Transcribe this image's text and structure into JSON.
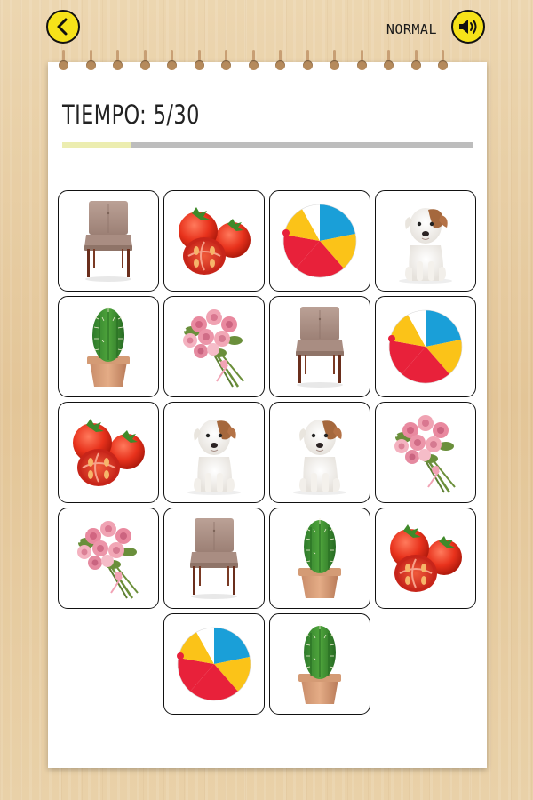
{
  "header": {
    "mode_label": "NORMAL",
    "back_icon": "chevron-left-icon",
    "sound_icon": "speaker-icon"
  },
  "timer": {
    "label": "TIEMPO: 5/30",
    "elapsed": 5,
    "total": 30,
    "progress_fraction": 0.1667,
    "fill_color": "#ecedb0",
    "track_color": "#bdbdbd"
  },
  "colors": {
    "button_yellow": "#f6e219",
    "background_wood": "#e8cfa6"
  },
  "board": {
    "rows": [
      [
        "chair",
        "tomato",
        "ball",
        "dog"
      ],
      [
        "cactus",
        "flowers",
        "chair",
        "ball"
      ],
      [
        "tomato",
        "dog",
        "dog",
        "flowers"
      ],
      [
        "flowers",
        "chair",
        "cactus",
        "tomato"
      ],
      [
        "ball",
        "cactus"
      ]
    ]
  }
}
